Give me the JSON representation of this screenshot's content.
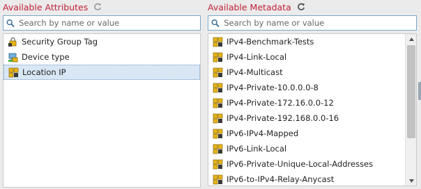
{
  "attributes": {
    "title": "Available Attributes",
    "search_placeholder": "Search by name or value",
    "items": [
      {
        "label": "Security Group Tag",
        "icon": "security-group-tag-icon"
      },
      {
        "label": "Device type",
        "icon": "device-type-icon"
      },
      {
        "label": "Location IP",
        "icon": "location-ip-icon",
        "selected": true
      }
    ]
  },
  "metadata": {
    "title": "Available Metadata",
    "search_placeholder": "Search by name or value",
    "items": [
      {
        "label": "IPv4-Benchmark-Tests"
      },
      {
        "label": "IPv4-Link-Local"
      },
      {
        "label": "IPv4-Multicast"
      },
      {
        "label": "IPv4-Private-10.0.0.0-8"
      },
      {
        "label": "IPv4-Private-172.16.0.0-12"
      },
      {
        "label": "IPv4-Private-192.168.0.0-16"
      },
      {
        "label": "IPv6-IPv4-Mapped"
      },
      {
        "label": "IPv6-Link-Local"
      },
      {
        "label": "IPv6-Private-Unique-Local-Addresses"
      },
      {
        "label": "IPv6-to-IPv4-Relay-Anycast"
      }
    ]
  },
  "colors": {
    "title": "#c0203a",
    "selection": "#d9e7f5",
    "search_border": "#7aa6c9"
  }
}
